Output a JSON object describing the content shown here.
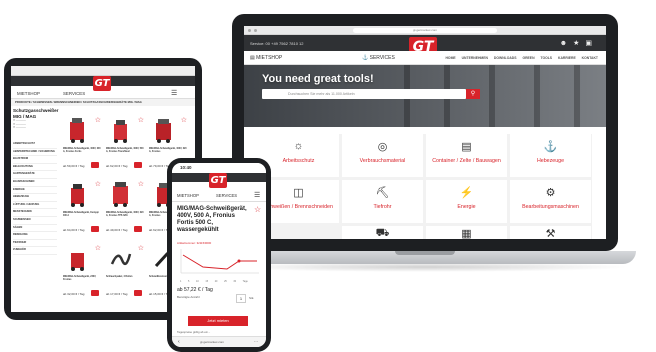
{
  "laptop": {
    "url": "gt.germantec.com",
    "phone_text": "Service: 00 +49 7562 7810 12",
    "logo": "GT",
    "nav": {
      "shop": "MIETSHOP",
      "services": "SERVICES",
      "links": "HOME   UNTERNEHMEN   DOWNLOADS   GREEN TOOLS   KARRIERE   KONTAKT"
    },
    "hero_title": "You need great tools!",
    "search_placeholder": "Durchsuchen Sie mehr als 11.000 Artikeln",
    "categories": [
      {
        "label": "Arbeitsschutz",
        "icon": "worker-icon"
      },
      {
        "label": "Verbrauchsmaterial",
        "icon": "reel-icon"
      },
      {
        "label": "Container / Zelte / Bauwagen",
        "icon": "container-icon"
      },
      {
        "label": "Hebezeuge",
        "icon": "hook-icon"
      },
      {
        "label": "Schweißen / Brennschneiden",
        "icon": "welder-icon"
      },
      {
        "label": "Tiefrohr",
        "icon": "excavator-icon"
      },
      {
        "label": "Energie",
        "icon": "plug-icon"
      },
      {
        "label": "Bearbeitungsmaschinen",
        "icon": "machine-icon"
      }
    ]
  },
  "tablet": {
    "logo": "GT",
    "nav": {
      "shop": "MIETSHOP",
      "services": "SERVICES"
    },
    "breadcrumb": "PRODUKTE / SCHWEISSEN / BRENNSCHNEIDEN / SCHUTZGASSCHWEISSGERÄTE MIG / MAG",
    "sidebar_title": "Schutzgasschweißer MIG / MAG",
    "sidebar_categories": [
      "ARBEITSSCHUTZ",
      "ABSPERRTECHNIK / SICHERUNG",
      "BAUSTROM",
      "BELEUCHTUNG",
      "GARTENGERÄTE",
      "BAUMASCHINEN",
      "ENERGIE",
      "HEBEZEUGE",
      "LÜFTUNG / HEIZUNG",
      "MESSTECHNIK",
      "SCHWEISSEN",
      "SÄGEN",
      "REINIGUNG",
      "TIEFROHR",
      "ZUBEHÖR"
    ],
    "products": [
      {
        "name": "MIG/MAG-Schweißgerät, 400V, 300 A, Fronius Fortis",
        "price": "ab 59,00 € / Tag"
      },
      {
        "name": "MIG/MAG-Schweißgerät, 400V, 500 A, Fronius TransSteel",
        "price": "ab 62,00 € / Tag"
      },
      {
        "name": "MIG/MAG-Schweißgerät, 400V, 320 A, Fronius",
        "price": "ab 79,00 € / Tag"
      },
      {
        "name": "MIG/MAG-Schweißgerät, Kemppi 400 A",
        "price": "ab 64,00 € / Tag"
      },
      {
        "name": "MIG/MAG-Schweißgerät, 400V, 320 A, Fronius TPS 320i",
        "price": "ab 49,00 € / Tag"
      },
      {
        "name": "MIG/MAG-Schweißgerät, 400V, 500 A, Fronius",
        "price": "ab 62,00 € / Tag"
      },
      {
        "name": "MIG/MAG-Schweißgerät, 230V, Fronius",
        "price": "ab 32,00 € / Tag"
      },
      {
        "name": "Schlauchpaket, 4 Rollen",
        "price": "ab 17,00 € / Tag"
      },
      {
        "name": "Schweißbrenner, 500 A",
        "price": "ab 15,00 € / Tag"
      }
    ]
  },
  "phone": {
    "time": "10:40",
    "logo": "GT",
    "nav": {
      "shop": "MIETSHOP",
      "services": "SERVICES"
    },
    "product_title": "MIG/MAG-Schweißgerät, 400V, 500 A, Fronius Fortis 500 C, wassergekühlt",
    "article_no": "Artikelnummer: 32115/9000",
    "chart_days": [
      "1",
      "5",
      "10",
      "15",
      "20",
      "25",
      "30 Tage"
    ],
    "price": "ab 57,22 € / Tag",
    "qty_label": "Benötigte Anzahl",
    "qty": "1",
    "qty_unit": "Stk.",
    "cta": "Jetzt mieten",
    "footer": "Tagespreise gültig ab ein...",
    "url": "gt.germantec.com"
  }
}
